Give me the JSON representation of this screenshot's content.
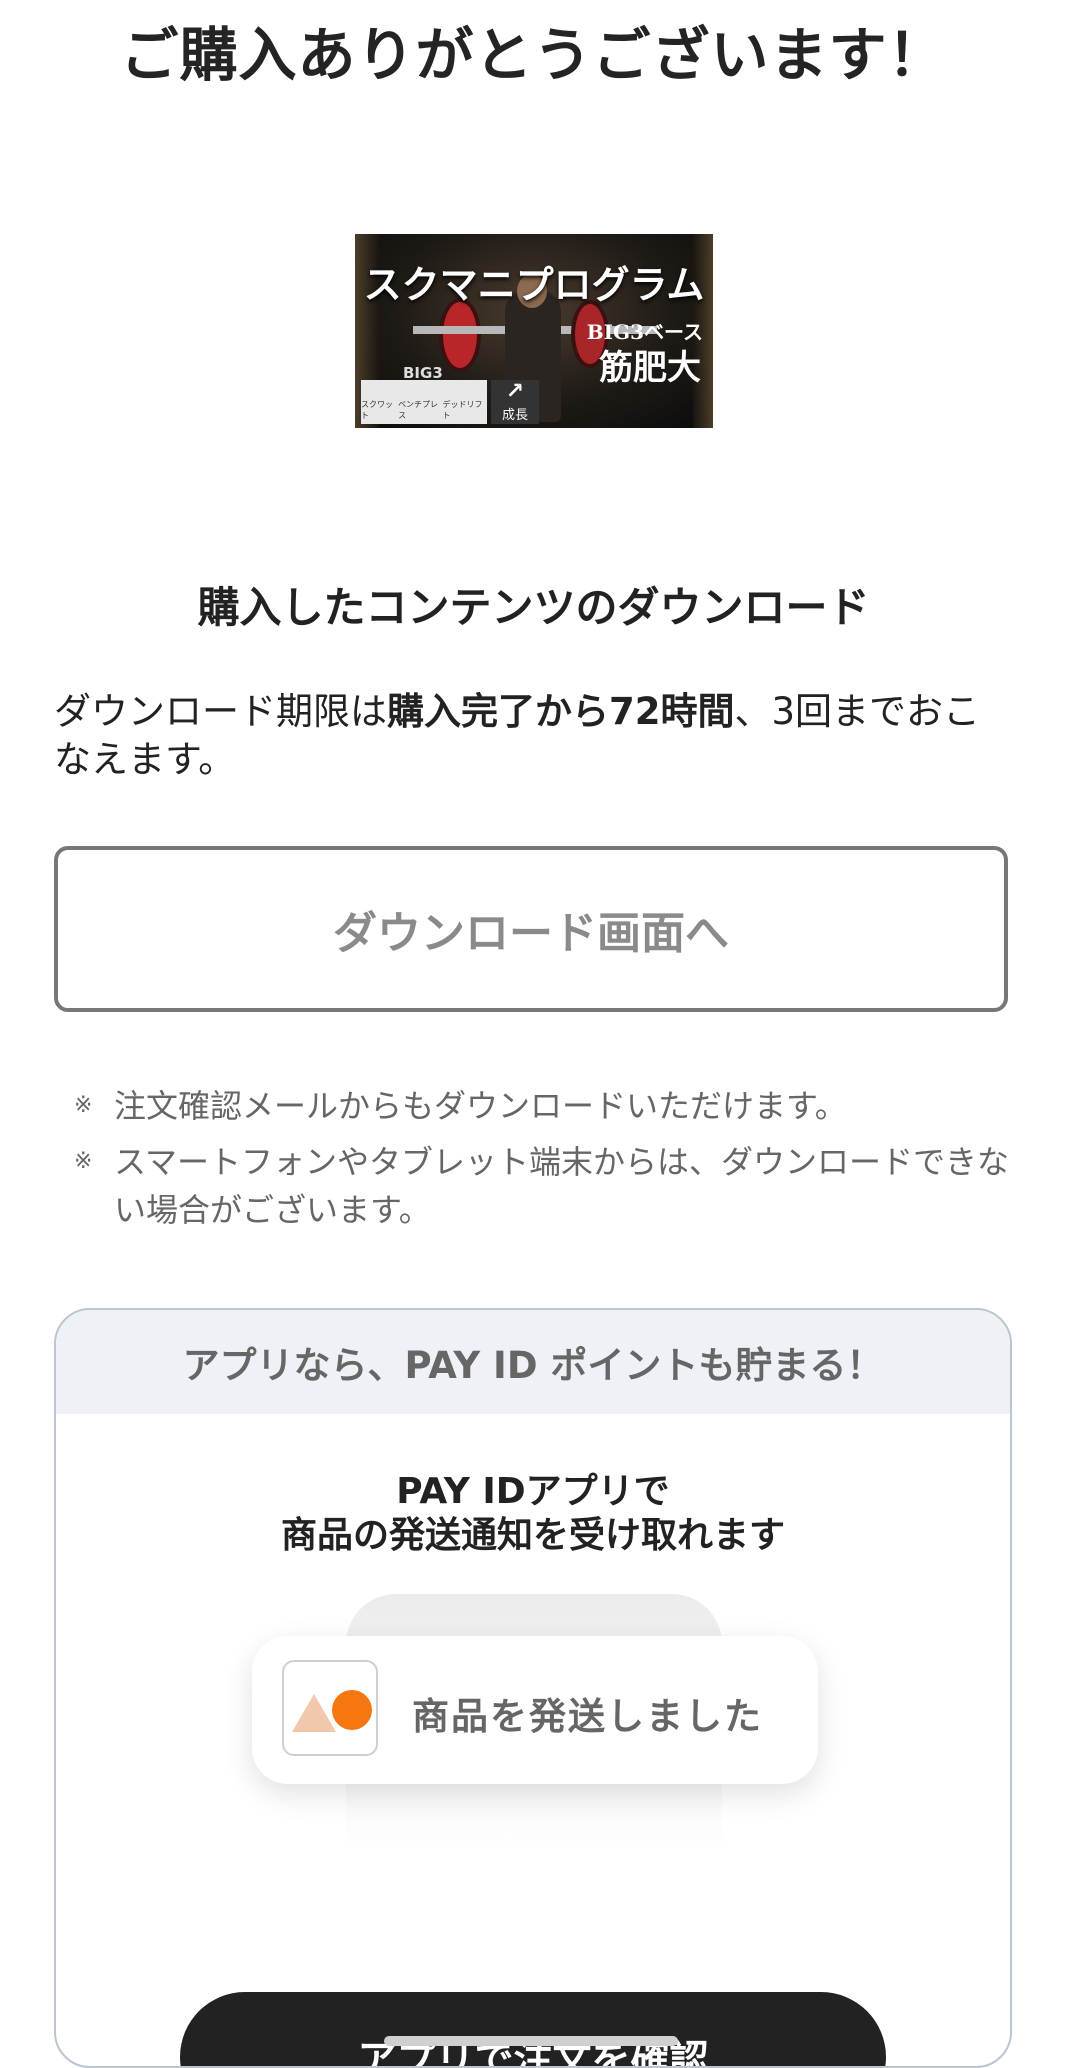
{
  "header": {
    "title": "ご購入ありがとうございます！"
  },
  "banner": {
    "title": "スクマニプログラム",
    "subtitle_small": "BIG3ベース",
    "subtitle_large": "筋肥大",
    "big3_label": "BIG3",
    "lift_labels": [
      "スクワット",
      "ベンチプレス",
      "デッドリフト"
    ],
    "growth_label": "成長"
  },
  "download": {
    "heading": "購入したコンテンツのダウンロード",
    "desc_part1": "ダウンロード期限は",
    "desc_bold": "購入完了から72時間",
    "desc_part2": "、3回までおこなえます。",
    "button_label": "ダウンロード画面へ",
    "notes": [
      "注文確認メールからもダウンロードいただけます。",
      "スマートフォンやタブレット端末からは、ダウンロードできない場合がございます。"
    ],
    "note_mark": "※"
  },
  "app_card": {
    "header": "アプリなら、PAY ID ポイントも貯まる！",
    "line1": "PAY IDアプリで",
    "line2": "商品の発送通知を受け取れます",
    "notification_text": "商品を発送しました",
    "cta_label": "アプリで注文を確認"
  }
}
